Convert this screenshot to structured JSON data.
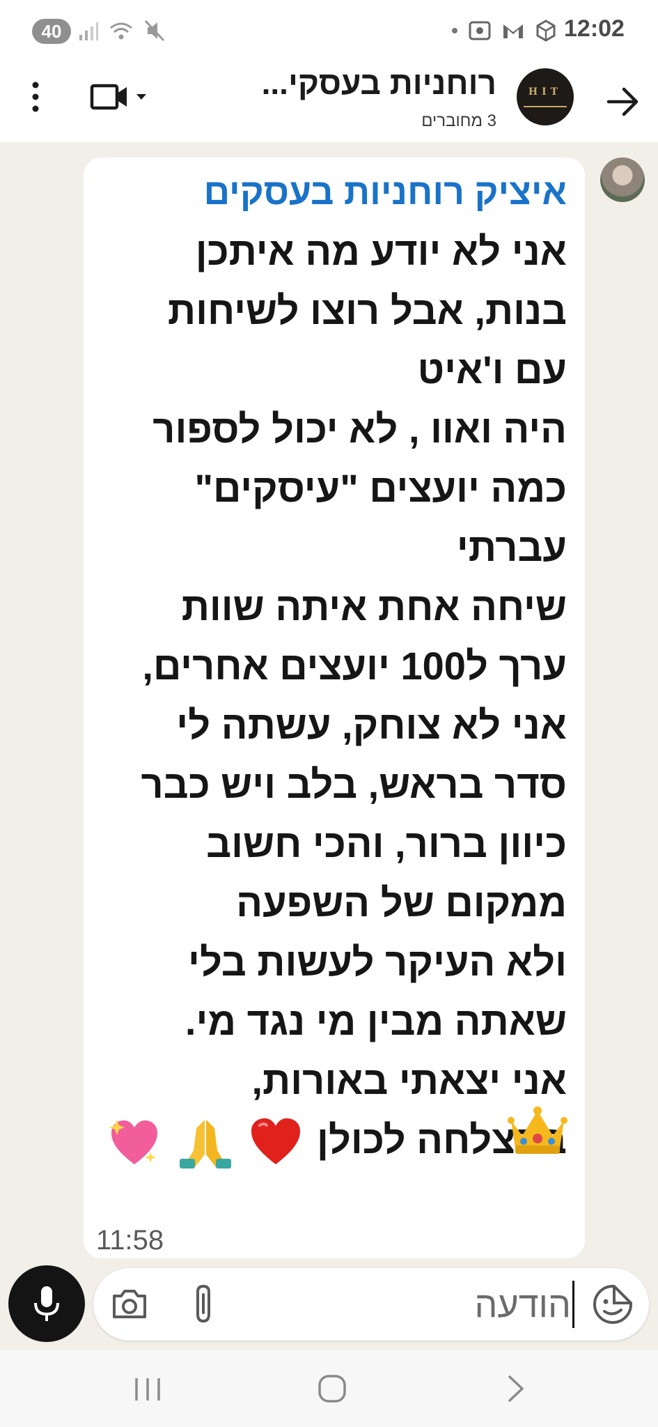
{
  "status_bar": {
    "battery": "40",
    "time": "12:02",
    "icons": [
      "signal-icon",
      "wifi-icon",
      "mute-icon",
      "dot-icon",
      "screen-record-icon",
      "gmail-icon",
      "vpn-icon"
    ]
  },
  "header": {
    "title": "רוחניות בעסקי...",
    "subtitle": "3 מחוברים",
    "icons": [
      "back-arrow-icon",
      "video-call-icon",
      "chevron-down-icon",
      "more-vert-icon"
    ]
  },
  "message": {
    "sender": "איציק רוחניות בעסקים",
    "lines": [
      "אני לא יודע מה איתכן",
      "בנות, אבל רוצו לשיחות",
      "עם ו'איט",
      "היה ואוו , לא יכול לספור",
      "כמה יועצים \"עיסקים\"",
      "עברתי",
      "שיחה אחת איתה שוות",
      "ערך ל100 יועצים אחרים,",
      "אני לא צוחק, עשתה לי",
      "סדר בראש, בלב ויש כבר",
      "כיוון ברור, והכי חשוב",
      "ממקום של השפעה",
      "ולא העיקר לעשות בלי",
      "שאתה מבין מי נגד מי.",
      "אני יצאתי באורות,"
    ],
    "last_line_text": "בהצלחה לכולן",
    "emojis": [
      "red-heart-emoji",
      "folded-hands-emoji",
      "sparkling-heart-emoji",
      "crown-emoji"
    ],
    "time": "11:58"
  },
  "composer": {
    "placeholder": "הודעה",
    "icons": [
      "mic-icon",
      "camera-icon",
      "paperclip-icon",
      "sticker-icon"
    ]
  },
  "colors": {
    "chat_background": "#f2efe9",
    "sender_name": "#1a73c9",
    "mic_button": "#141414"
  }
}
